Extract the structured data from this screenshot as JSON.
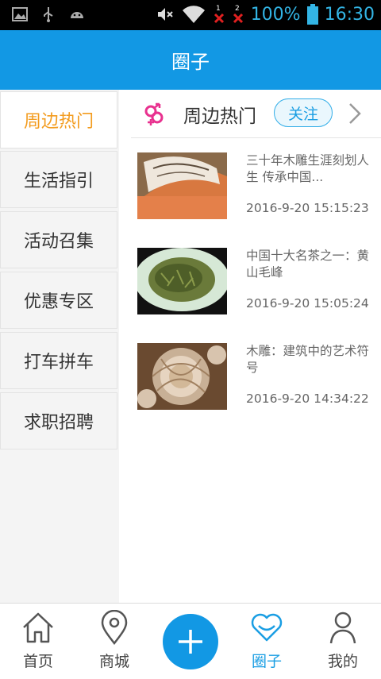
{
  "status_bar": {
    "battery": "100%",
    "time": "16:30",
    "sim1": "1",
    "sim2": "2",
    "icons": [
      "image-icon",
      "usb-icon",
      "android-icon",
      "mute-icon",
      "wifi-icon",
      "no-signal-icon",
      "battery-icon"
    ]
  },
  "header": {
    "title": "圈子"
  },
  "sidebar": {
    "items": [
      {
        "label": "周边热门",
        "active": true
      },
      {
        "label": "生活指引"
      },
      {
        "label": "活动召集"
      },
      {
        "label": "优惠专区"
      },
      {
        "label": "打车拼车"
      },
      {
        "label": "求职招聘"
      }
    ]
  },
  "section": {
    "title": "周边热门",
    "follow_label": "关注",
    "icon": "gender-icon",
    "accent": "#e8318f"
  },
  "posts": [
    {
      "title": "三十年木雕生涯刻划人生 传承中国...",
      "time": "2016-9-20 15:15:23",
      "thumb": "woodcarving-photo"
    },
    {
      "title": "中国十大名茶之一：黄山毛峰",
      "time": "2016-9-20 15:05:24",
      "thumb": "tea-photo"
    },
    {
      "title": "木雕：建筑中的艺术符号",
      "time": "2016-9-20 14:34:22",
      "thumb": "carved-flower-photo"
    }
  ],
  "bottom_nav": [
    {
      "label": "首页",
      "icon": "home-icon"
    },
    {
      "label": "商城",
      "icon": "location-icon"
    },
    {
      "label": "",
      "icon": "plus-icon"
    },
    {
      "label": "圈子",
      "icon": "heart-icon",
      "active": true
    },
    {
      "label": "我的",
      "icon": "person-icon"
    }
  ],
  "colors": {
    "primary": "#1298e4",
    "active_side": "#f39c1f",
    "status_text": "#33b5e5"
  }
}
